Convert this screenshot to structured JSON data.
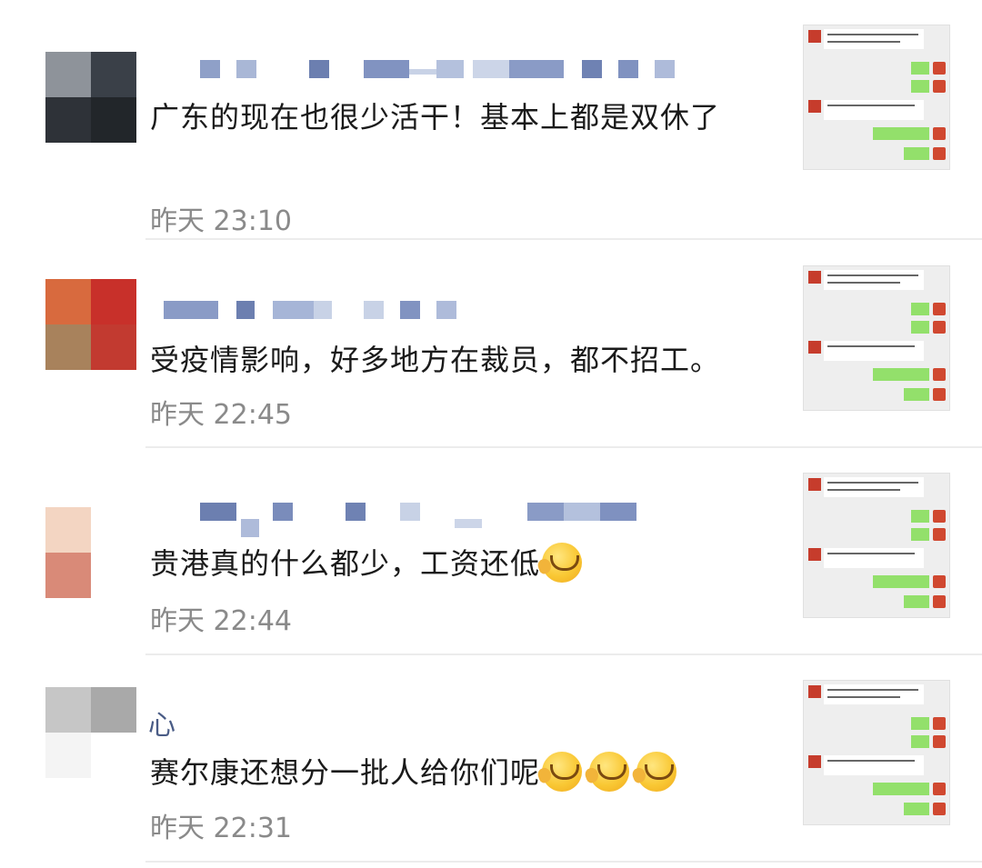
{
  "comments": [
    {
      "text": "广东的现在也很少活干！基本上都是双休了",
      "time": "昨天 23:10",
      "avatar_colors": [
        "#8e939a",
        "#3a4048",
        "#2e3238",
        "#22262a"
      ],
      "name_visible": "",
      "emoji_count": 0
    },
    {
      "text": "受疫情影响，好多地方在裁员，都不招工。",
      "time": "昨天 22:45",
      "avatar_colors": [
        "#d86a3e",
        "#c8302a",
        "#a8825c",
        "#c23a30"
      ],
      "name_visible": "",
      "emoji_count": 0
    },
    {
      "text": "贵港真的什么都少，工资还低",
      "time": "昨天 22:44",
      "avatar_colors": [
        "#f3d5c2",
        "#ffffff",
        "#d98a78",
        "#ffffff"
      ],
      "name_visible": "",
      "emoji_count": 1
    },
    {
      "text": "赛尔康还想分一批人给你们呢",
      "time": "昨天 22:31",
      "avatar_colors": [
        "#c6c6c6",
        "#a9a9a9",
        "#f4f4f4",
        "#ffffff"
      ],
      "name_visible": "心",
      "emoji_count": 3
    }
  ],
  "emoji_name": "crying-laughing-facepalm-emoji",
  "colors": {
    "text": "#1a1a1a",
    "time": "#8a8a8a",
    "name": "#4a5c86",
    "bubble_green": "#93e06b",
    "divider": "#ececec"
  }
}
